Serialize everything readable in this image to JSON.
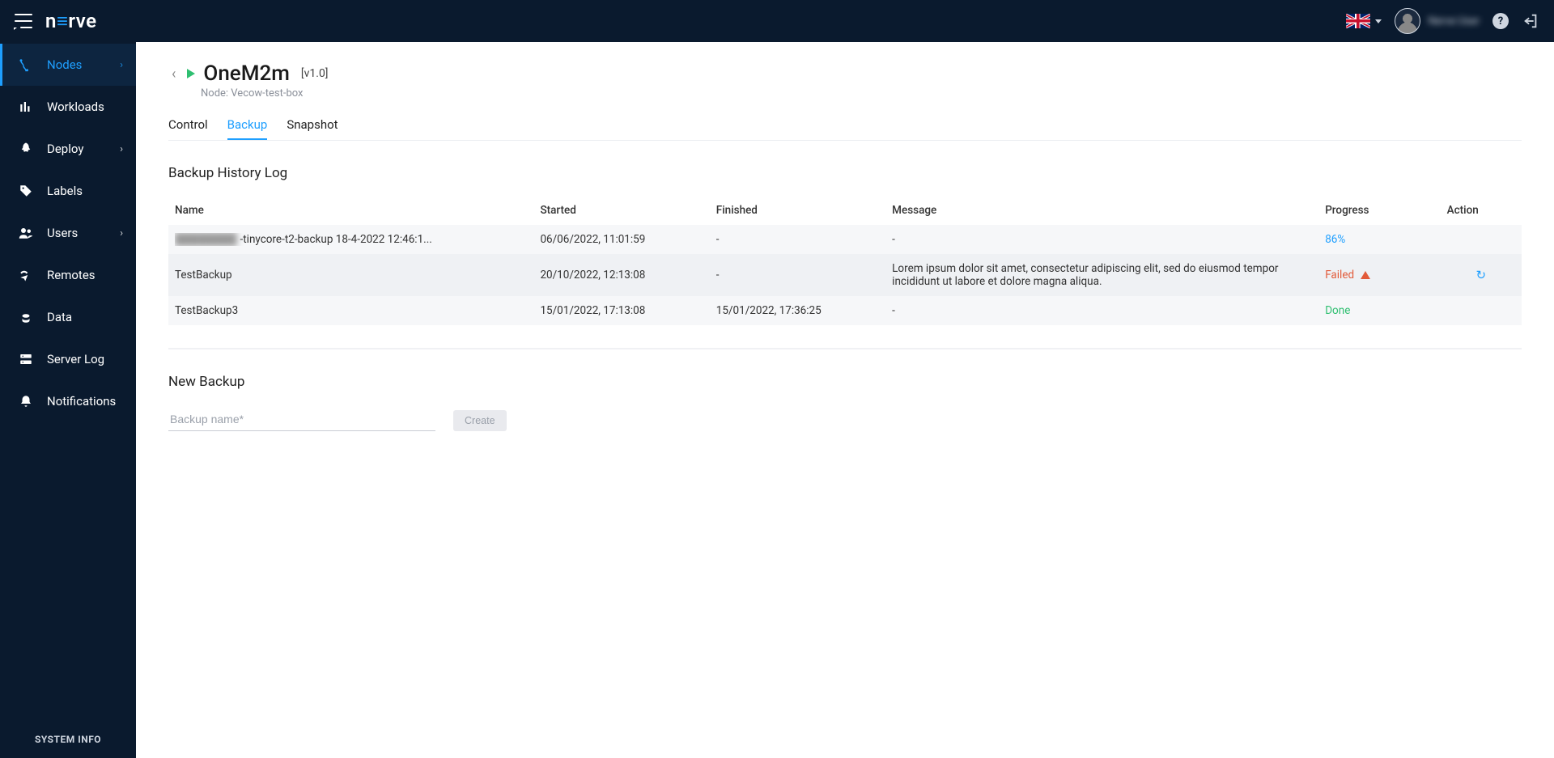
{
  "brand": {
    "part1": "n",
    "accent": "≡",
    "part2": "rve"
  },
  "topbar": {
    "username": "Nerve User",
    "language": "en-GB"
  },
  "sidebar": {
    "items": [
      {
        "label": "Nodes",
        "slug": "nodes",
        "hasSub": true,
        "active": true
      },
      {
        "label": "Workloads",
        "slug": "workloads",
        "hasSub": false,
        "active": false
      },
      {
        "label": "Deploy",
        "slug": "deploy",
        "hasSub": true,
        "active": false
      },
      {
        "label": "Labels",
        "slug": "labels",
        "hasSub": false,
        "active": false
      },
      {
        "label": "Users",
        "slug": "users",
        "hasSub": true,
        "active": false
      },
      {
        "label": "Remotes",
        "slug": "remotes",
        "hasSub": false,
        "active": false
      },
      {
        "label": "Data",
        "slug": "data",
        "hasSub": false,
        "active": false
      },
      {
        "label": "Server Log",
        "slug": "server-log",
        "hasSub": false,
        "active": false
      },
      {
        "label": "Notifications",
        "slug": "notifications",
        "hasSub": false,
        "active": false
      }
    ],
    "footer": "SYSTEM INFO"
  },
  "page": {
    "title": "OneM2m",
    "version": "[v1.0]",
    "node_prefix": "Node: ",
    "node_name": "Vecow-test-box",
    "tabs": {
      "control": "Control",
      "backup": "Backup",
      "snapshot": "Snapshot",
      "active": "backup"
    },
    "backup_log_title": "Backup History Log",
    "columns": {
      "name": "Name",
      "started": "Started",
      "finished": "Finished",
      "message": "Message",
      "progress": "Progress",
      "action": "Action"
    },
    "rows": [
      {
        "name_hidden": "████████",
        "name_rest": "-tinycore-t2-backup 18-4-2022 12:46:1...",
        "started": "06/06/2022, 11:01:59",
        "finished": "-",
        "message": "-",
        "progress": {
          "status": "in-progress",
          "text": "86%"
        },
        "action": null
      },
      {
        "name_hidden": "",
        "name_rest": "TestBackup",
        "started": "20/10/2022, 12:13:08",
        "finished": "-",
        "message": "Lorem ipsum dolor sit amet, consectetur adipiscing elit, sed do eiusmod tempor incididunt ut labore et dolore magna aliqua.",
        "progress": {
          "status": "failed",
          "text": "Failed"
        },
        "action": "reload"
      },
      {
        "name_hidden": "",
        "name_rest": "TestBackup3",
        "started": "15/01/2022, 17:13:08",
        "finished": "15/01/2022, 17:36:25",
        "message": "-",
        "progress": {
          "status": "done",
          "text": "Done"
        },
        "action": null
      }
    ],
    "new_backup_title": "New Backup",
    "backup_name_placeholder": "Backup name*",
    "create_button": "Create"
  }
}
